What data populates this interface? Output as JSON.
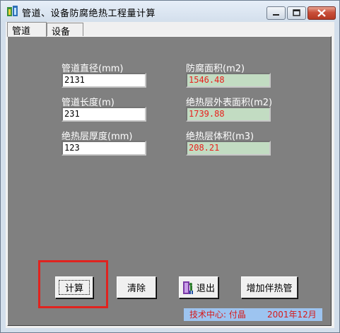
{
  "window": {
    "title": "管道、设备防腐绝热工程量计算",
    "controls": {
      "minimize": "minimize",
      "maximize": "maximize",
      "close": "close"
    }
  },
  "tabs": [
    {
      "label": "管道",
      "active": true
    },
    {
      "label": "设备",
      "active": false
    }
  ],
  "inputs": {
    "diameter": {
      "label": "管道直径(mm)",
      "value": "2131"
    },
    "length": {
      "label": "管道长度(m)",
      "value": "231"
    },
    "thickness": {
      "label": "绝热层厚度(mm)",
      "value": "123"
    }
  },
  "outputs": {
    "anticorrosion_area": {
      "label": "防腐面积(m2)",
      "value": "1546.48"
    },
    "insulation_surface_area": {
      "label": "绝热层外表面积(m2)",
      "value": "1739.88"
    },
    "insulation_volume": {
      "label": "绝热层体积(m3)",
      "value": "208.21"
    }
  },
  "buttons": {
    "calculate": "计算",
    "clear": "清除",
    "exit": "退出",
    "add_tracing": "增加伴热管"
  },
  "footer": {
    "credit": "技术中心: 付晶",
    "date": "2001年12月"
  },
  "colors": {
    "panel": "#808080",
    "output_bg": "#c2dcc2",
    "output_text": "#e8201c",
    "footer_bg": "#9dc4f0",
    "footer_text": "#d61a1a",
    "highlight": "#e0231f"
  }
}
